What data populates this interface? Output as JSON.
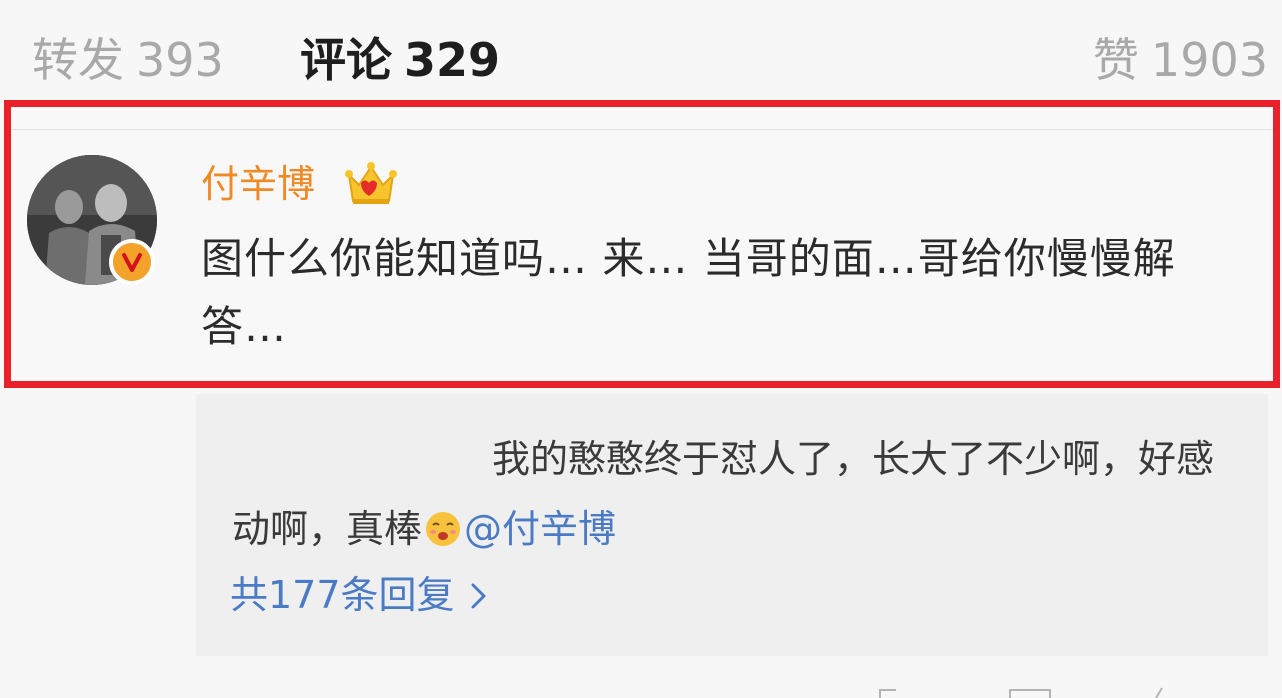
{
  "tabs": {
    "repost": {
      "label": "转发",
      "count": "393"
    },
    "comment": {
      "label": "评论",
      "count": "329"
    },
    "like": {
      "label": "赞",
      "count": "1903"
    }
  },
  "comment": {
    "username": "付辛博",
    "text": "图什么你能知道吗… 来… 当哥的面…哥给你慢慢解答…"
  },
  "reply": {
    "text_before": "我的憨憨终于怼人了，长大了不少啊，好感动啊，真棒",
    "mention": "@付辛博",
    "replies_link": "共177条回复"
  },
  "colors": {
    "highlight_border": "#e8212a",
    "username": "#f08a24",
    "link": "#4a7bc4",
    "tab_indicator": "#f5a623"
  },
  "icons": [
    "crown-icon",
    "verified-badge-icon",
    "emoji-icon",
    "chevron-right-icon"
  ]
}
